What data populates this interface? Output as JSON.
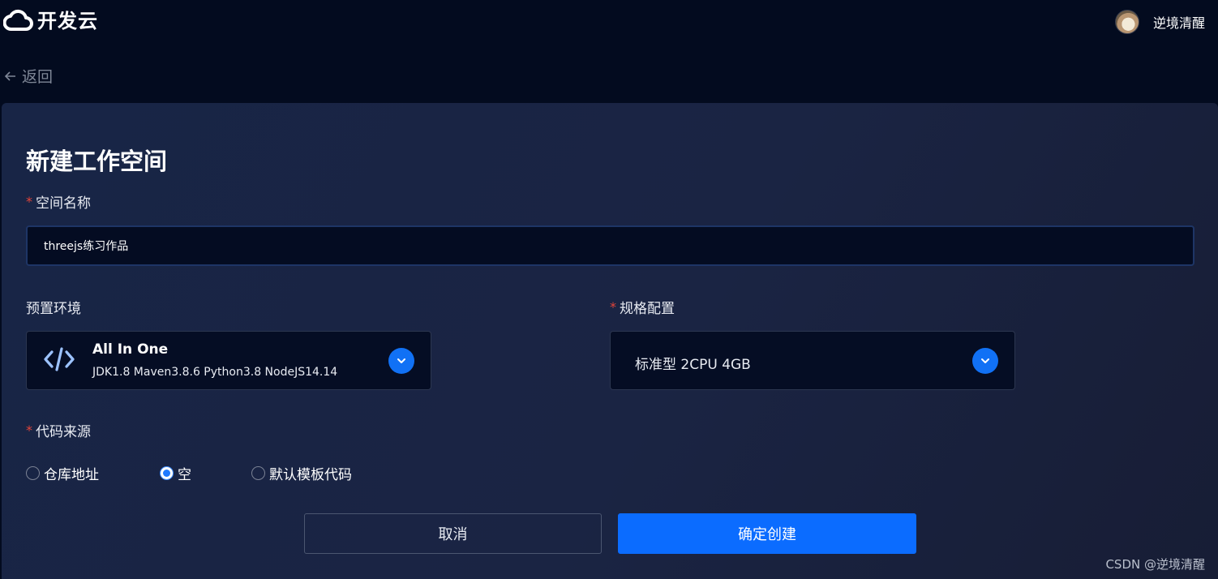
{
  "header": {
    "app_name": "开发云",
    "user_name": "逆境清醒"
  },
  "nav": {
    "back_label": "返回"
  },
  "form": {
    "title": "新建工作空间",
    "name_field": {
      "label": "空间名称",
      "required_mark": "*",
      "value": "threejs练习作品"
    },
    "env_field": {
      "label": "预置环境",
      "selected_name": "All In One",
      "selected_desc": "JDK1.8 Maven3.8.6 Python3.8 NodeJS14.14"
    },
    "spec_field": {
      "label": "规格配置",
      "required_mark": "*",
      "selected_value": "标准型 2CPU 4GB"
    },
    "source_field": {
      "label": "代码来源",
      "required_mark": "*",
      "options": [
        "仓库地址",
        "空",
        "默认模板代码"
      ],
      "selected": "空"
    },
    "cancel_label": "取消",
    "submit_label": "确定创建"
  },
  "watermark": "CSDN @逆境清醒",
  "colors": {
    "page_bg": "#030b1f",
    "panel_bg": "#182546",
    "accent": "#0b6cff",
    "required": "#e2453a"
  },
  "icons": [
    "cloud-logo-icon",
    "avatar",
    "arrow-left-icon",
    "code-icon",
    "chevron-down-icon"
  ]
}
